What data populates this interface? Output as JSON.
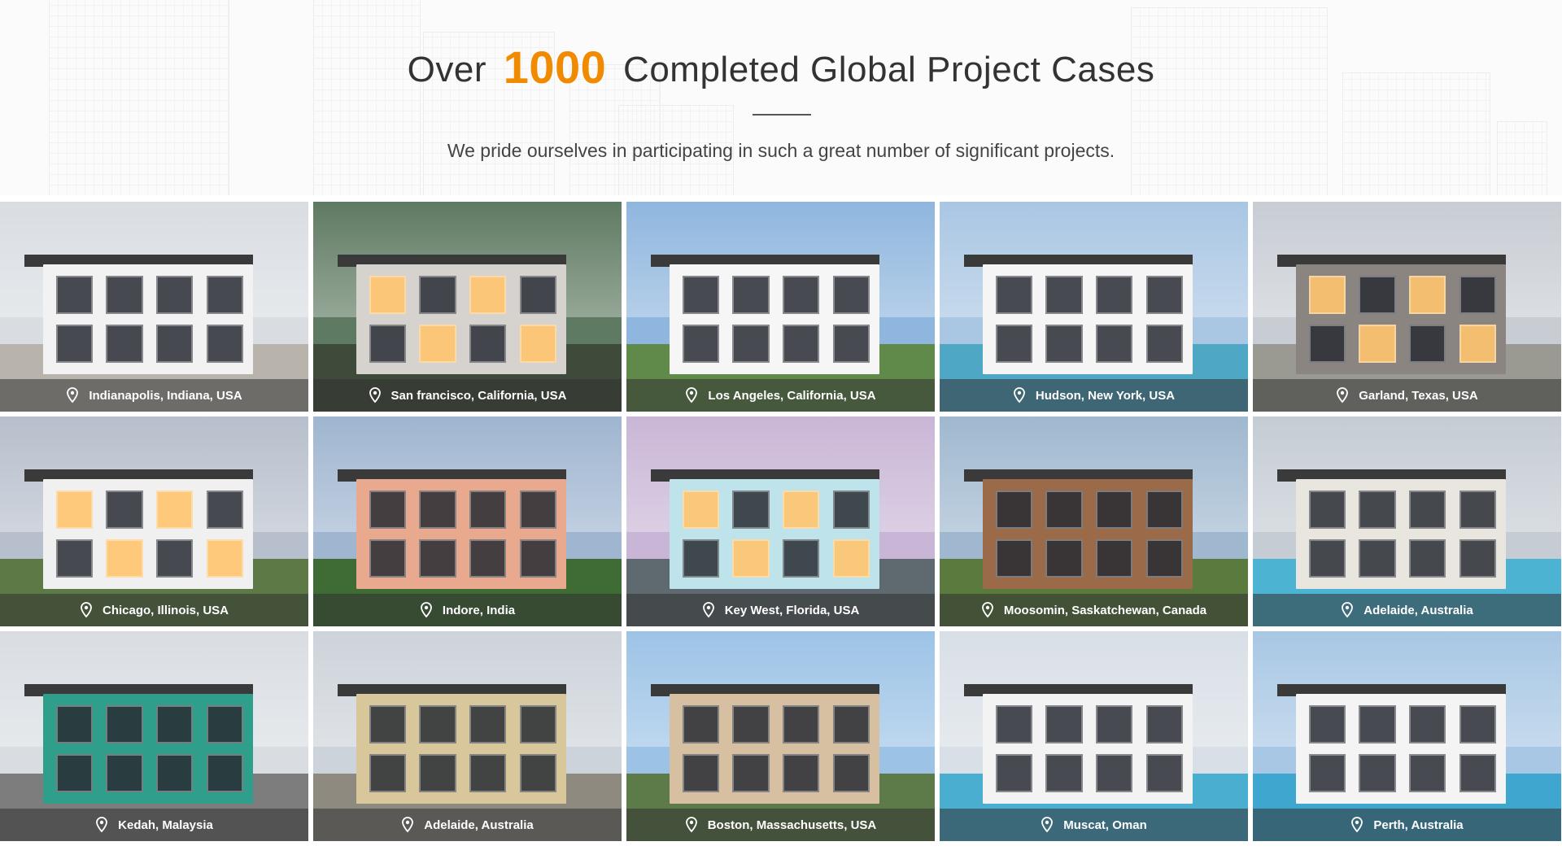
{
  "header": {
    "headline_prefix": "Over",
    "headline_number": "1000",
    "headline_suffix": "Completed Global Project Cases",
    "subtitle": "We pride ourselves in participating in such a great number of significant projects.",
    "accent_color": "#f08a00"
  },
  "projects": [
    {
      "location": "Indianapolis, Indiana, USA",
      "sky": "#d9dde2",
      "wall": "#f2f2f2",
      "ground": "#b9b4ab",
      "lit": false
    },
    {
      "location": "San francisco, California, USA",
      "sky": "#5f7a62",
      "wall": "#d6d3cf",
      "ground": "#3e4b3a",
      "lit": true
    },
    {
      "location": "Los Angeles, California, USA",
      "sky": "#8fb6de",
      "wall": "#f6f6f6",
      "ground": "#5f8a4a",
      "lit": false
    },
    {
      "location": "Hudson, New York, USA",
      "sky": "#a9c6e3",
      "wall": "#f5f5f5",
      "ground": "#4fa7c6",
      "lit": false
    },
    {
      "location": "Garland, Texas, USA",
      "sky": "#c8cdd4",
      "wall": "#8a8580",
      "ground": "#9a9a92",
      "lit": true
    },
    {
      "location": "Chicago, Illinois, USA",
      "sky": "#b7bfcc",
      "wall": "#f0f0f0",
      "ground": "#5d7a46",
      "lit": true
    },
    {
      "location": "Indore, India",
      "sky": "#9fb5d0",
      "wall": "#e8a98f",
      "ground": "#3f6b35",
      "lit": false
    },
    {
      "location": "Key West,  Florida, USA",
      "sky": "#c9b6d6",
      "wall": "#bfe3ea",
      "ground": "#5e6a70",
      "lit": true
    },
    {
      "location": "Moosomin, Saskatchewan, Canada",
      "sky": "#9fb8cf",
      "wall": "#9b6a48",
      "ground": "#5a7a3e",
      "lit": false
    },
    {
      "location": "Adelaide, Australia",
      "sky": "#c5ccd4",
      "wall": "#e9e6df",
      "ground": "#4db3d3",
      "lit": false
    },
    {
      "location": "Kedah, Malaysia",
      "sky": "#d9dde2",
      "wall": "#2f9e8a",
      "ground": "#7d7d7d",
      "lit": false
    },
    {
      "location": "Adelaide, Australia",
      "sky": "#cdd3da",
      "wall": "#d8c79a",
      "ground": "#8f8a80",
      "lit": false
    },
    {
      "location": "Boston, Massachusetts, USA",
      "sky": "#9cc3e6",
      "wall": "#d7c0a1",
      "ground": "#5c7b48",
      "lit": false
    },
    {
      "location": "Muscat, Oman",
      "sky": "#d8dfe6",
      "wall": "#f3f3f3",
      "ground": "#4aaed0",
      "lit": false
    },
    {
      "location": "Perth, Australia",
      "sky": "#a8c7e4",
      "wall": "#f4f4f4",
      "ground": "#3ea6cf",
      "lit": false
    }
  ]
}
